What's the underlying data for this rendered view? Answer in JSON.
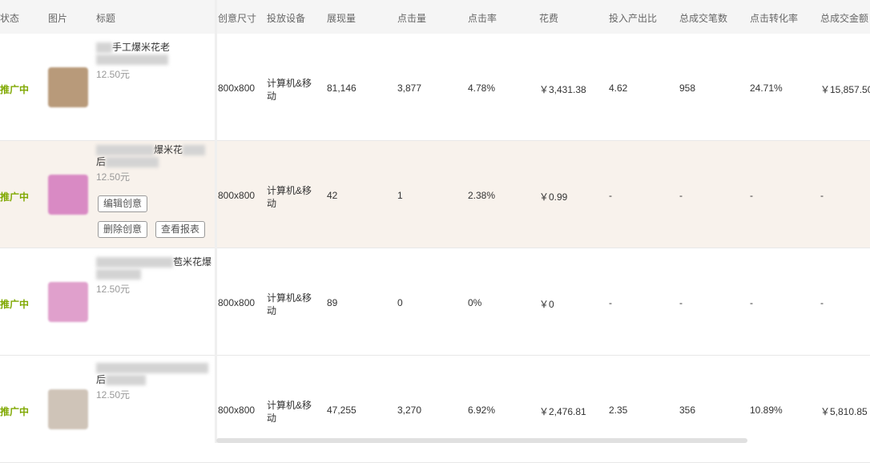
{
  "headers": [
    "状态",
    "图片",
    "标题",
    "创意尺寸",
    "投放设备",
    "展现量",
    "点击量",
    "点击率",
    "花费",
    "投入产出比",
    "总成交笔数",
    "点击转化率",
    "总成交金额"
  ],
  "rows": [
    {
      "status": "推广中",
      "title_visible": "手工爆米花老",
      "price": "12.50元",
      "size": "800x800",
      "device": "计算机&移动",
      "impressions": "81,146",
      "clicks": "3,877",
      "ctr": "4.78%",
      "cost": "￥3,431.38",
      "roi": "4.62",
      "orders": "958",
      "cvr": "24.71%",
      "gmv": "￥15,857.50",
      "thumb_color": "#b89a7a"
    },
    {
      "status": "推广中",
      "title_visible": "爆米花",
      "title_visible2": "后",
      "price": "12.50元",
      "size": "800x800",
      "device": "计算机&移动",
      "impressions": "42",
      "clicks": "1",
      "ctr": "2.38%",
      "cost": "￥0.99",
      "roi": "-",
      "orders": "-",
      "cvr": "-",
      "gmv": "-",
      "thumb_color": "#d98ac4",
      "buttons": {
        "edit": "编辑创意",
        "delete": "删除创意",
        "report": "查看报表"
      }
    },
    {
      "status": "推广中",
      "title_visible": "苞米花爆",
      "price": "12.50元",
      "size": "800x800",
      "device": "计算机&移动",
      "impressions": "89",
      "clicks": "0",
      "ctr": "0%",
      "cost": "￥0",
      "roi": "-",
      "orders": "-",
      "cvr": "-",
      "gmv": "-",
      "thumb_color": "#e0a0cc"
    },
    {
      "status": "推广中",
      "title_visible": "后",
      "price": "12.50元",
      "size": "800x800",
      "device": "计算机&移动",
      "impressions": "47,255",
      "clicks": "3,270",
      "ctr": "6.92%",
      "cost": "￥2,476.81",
      "roi": "2.35",
      "orders": "356",
      "cvr": "10.89%",
      "gmv": "￥5,810.85",
      "thumb_color": "#cfc4b8"
    }
  ]
}
